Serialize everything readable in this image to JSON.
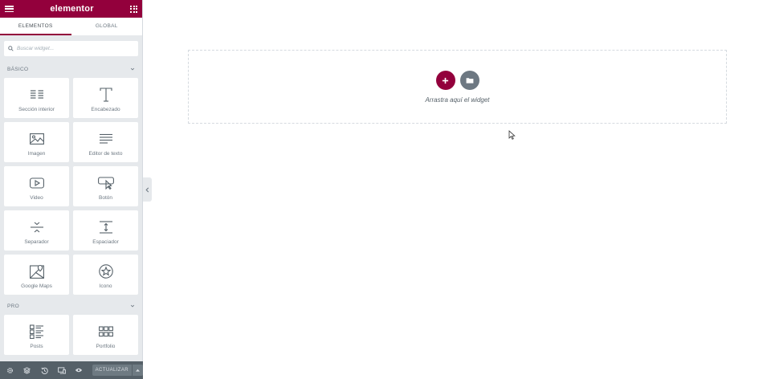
{
  "panel": {
    "brand": "elementor",
    "tabs": [
      "ELEMENTOS",
      "GLOBAL"
    ],
    "search": {
      "placeholder": "Buscar widget..."
    },
    "categories": [
      {
        "title": "BÁSICO",
        "widgets": [
          {
            "label": "Sección interior",
            "icon": "inner-section-icon"
          },
          {
            "label": "Encabezado",
            "icon": "heading-icon"
          },
          {
            "label": "Imagen",
            "icon": "image-icon"
          },
          {
            "label": "Editor de texto",
            "icon": "text-editor-icon"
          },
          {
            "label": "Video",
            "icon": "video-icon"
          },
          {
            "label": "Botón",
            "icon": "button-icon"
          },
          {
            "label": "Separador",
            "icon": "divider-icon"
          },
          {
            "label": "Espaciador",
            "icon": "spacer-icon"
          },
          {
            "label": "Google Maps",
            "icon": "google-maps-icon"
          },
          {
            "label": "Icono",
            "icon": "star-icon"
          }
        ]
      },
      {
        "title": "PRO",
        "widgets": [
          {
            "label": "Posts",
            "icon": "posts-icon"
          },
          {
            "label": "Portfolio",
            "icon": "portfolio-icon"
          }
        ]
      }
    ]
  },
  "footer": {
    "icons": [
      "settings-icon",
      "navigator-icon",
      "history-icon",
      "responsive-icon",
      "preview-icon"
    ],
    "update_label": "ACTUALIZAR"
  },
  "canvas": {
    "dropzone_text": "Arrastra aquí el widget"
  },
  "colors": {
    "brand": "#93003c",
    "panel_bg": "#e6e9ec",
    "footer_bg": "#556068",
    "add_template": "#6d7882"
  }
}
